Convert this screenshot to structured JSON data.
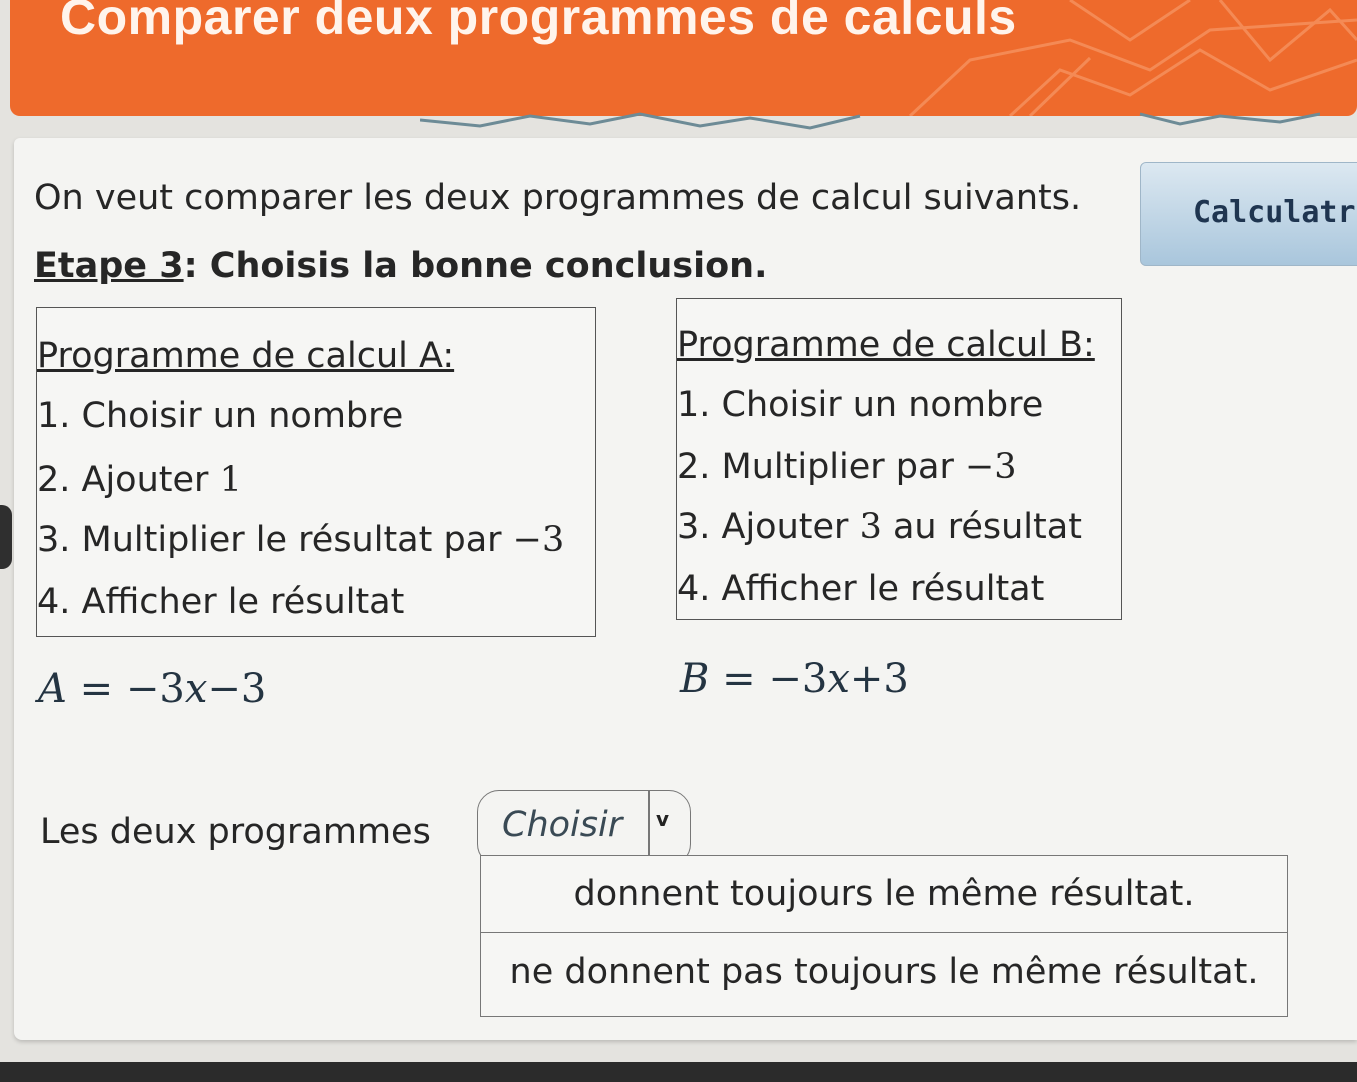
{
  "header": {
    "title": "Comparer deux programmes de calculs"
  },
  "calculator_button": {
    "label": "Calculatri"
  },
  "intro": "On veut comparer les deux programmes de calcul suivants.",
  "step": {
    "label": "Etape 3",
    "text": ": Choisis la bonne conclusion."
  },
  "program_a": {
    "title": "Programme de calcul A:",
    "steps": [
      {
        "prefix": "1. Choisir un nombre",
        "num": ""
      },
      {
        "prefix": "2. Ajouter ",
        "num": "1"
      },
      {
        "prefix": "3. Multiplier le résultat par ",
        "num": "−3"
      },
      {
        "prefix": "4. Afficher le résultat",
        "num": ""
      }
    ]
  },
  "program_b": {
    "title": "Programme de calcul B:",
    "steps": [
      {
        "prefix": "1. Choisir un nombre",
        "num": "",
        "suffix": ""
      },
      {
        "prefix": "2. Multiplier par ",
        "num": "−3",
        "suffix": ""
      },
      {
        "prefix": "3. Ajouter ",
        "num": "3",
        "suffix": " au résultat"
      },
      {
        "prefix": "4. Afficher le résultat",
        "num": "",
        "suffix": ""
      }
    ]
  },
  "formula_a": {
    "var": "A",
    "eq": " = ",
    "expr_pre": "−3",
    "x": "x",
    "expr_post": "−3"
  },
  "formula_b": {
    "var": "B",
    "eq": " = ",
    "expr_pre": "−3",
    "x": "x",
    "expr_post": "+3"
  },
  "conclusion": {
    "text": "Les deux programmes",
    "select_value": "Choisir",
    "chevron": "v",
    "options": [
      "donnent toujours le même résultat.",
      "ne donnent pas toujours le même résultat."
    ]
  },
  "colors": {
    "header": "#ee6a2c",
    "formula": "#243442",
    "button": "#a9c6dc"
  }
}
